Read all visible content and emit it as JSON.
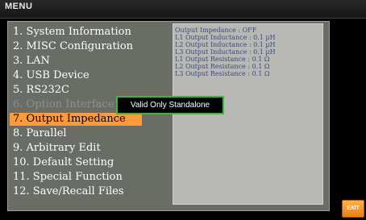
{
  "header": {
    "title": "MENU"
  },
  "menu": {
    "items": [
      {
        "label": "1. System Information"
      },
      {
        "label": "2. MISC Configuration"
      },
      {
        "label": "3. LAN"
      },
      {
        "label": "4. USB Device"
      },
      {
        "label": "5. RS232C"
      },
      {
        "label": "6. Option Interface"
      },
      {
        "label": "7. Output Impedance"
      },
      {
        "label": "8. Parallel"
      },
      {
        "label": "9. Arbitrary Edit"
      },
      {
        "label": "10. Default Setting"
      },
      {
        "label": "11. Special Function"
      },
      {
        "label": "12. Save/Recall Files"
      }
    ]
  },
  "info": {
    "lines": [
      "Output Impedance : OFF",
      "L1 Output Inductance : 0.1 µH",
      "L2 Output Inductance : 0.1 µH",
      "L3 Output Inductance : 0.1 µH",
      "L1 Output Resistance : 0.1 Ω",
      "L2 Output Resistance : 0.1 Ω",
      "L3 Output Resistance : 0.1 Ω"
    ]
  },
  "popup": {
    "message": "Valid Only Standalone"
  },
  "softkey": {
    "exit_label": "EXIT"
  }
}
